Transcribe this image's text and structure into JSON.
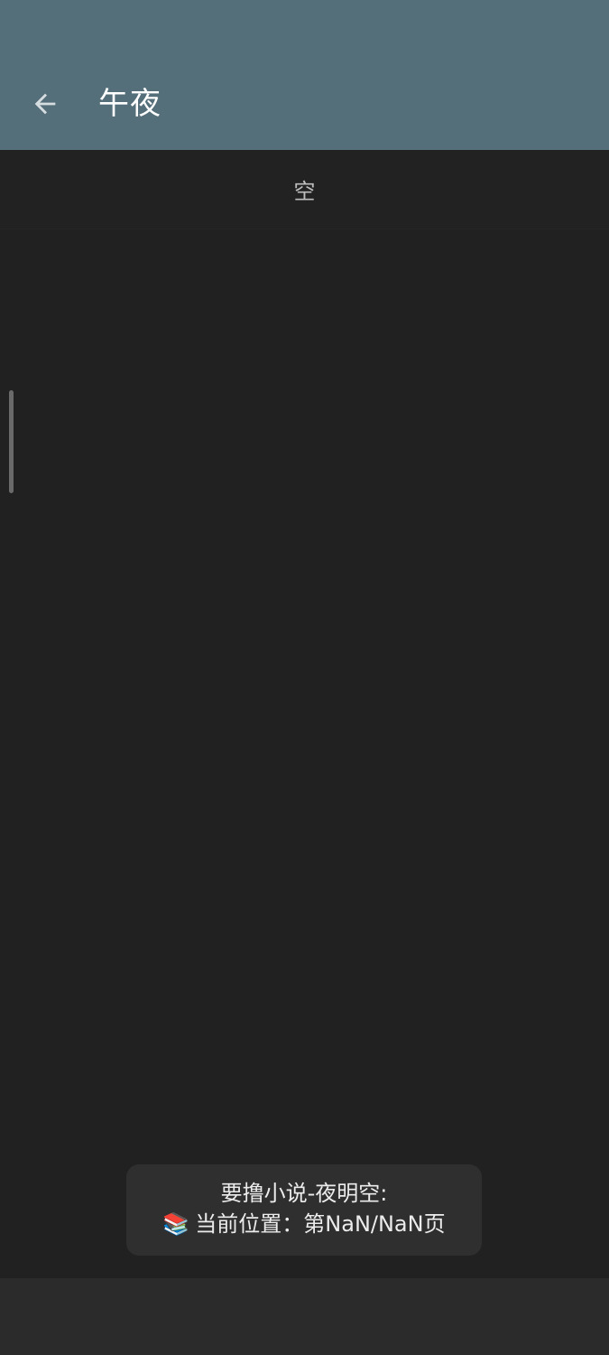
{
  "app_bar": {
    "title": "午夜",
    "back_icon": "arrow-back-icon",
    "background": "#546e7a"
  },
  "content": {
    "empty_label": "空"
  },
  "toast": {
    "line1": "要撸小说-夜明空:",
    "line2_icon": "📚",
    "line2_text": "当前位置：第NaN/NaN页"
  },
  "colors": {
    "background": "#212121",
    "toast_background": "#2f2f2f",
    "bottom_bar": "#2b2b2b"
  }
}
